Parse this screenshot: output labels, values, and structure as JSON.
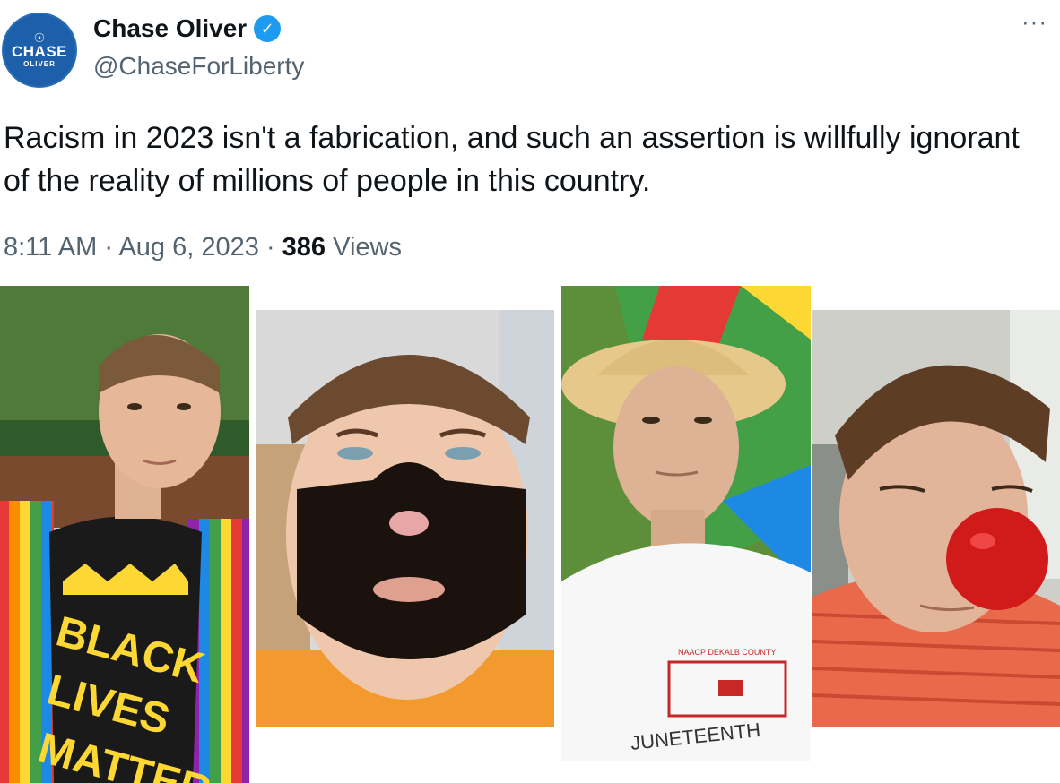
{
  "author": {
    "avatar_text_line1": "CHASE",
    "avatar_text_line2": "OLIVER",
    "display_name": "Chase Oliver",
    "handle": "@ChaseForLiberty",
    "verified": true
  },
  "tweet": {
    "text": "Racism in 2023 isn't a fabrication, and such an assertion is willfully ignorant of the reality of millions of people in this country.",
    "time": "8:11 AM",
    "date": "Aug 6, 2023",
    "views_count": "386",
    "views_label": "Views",
    "separator": "·"
  },
  "menu": {
    "more_icon": "more-horizontal-icon",
    "label": "···"
  },
  "photos": {
    "photo1": {
      "shirt_text_1": "BLACK",
      "shirt_text_2": "LIVES",
      "shirt_text_3": "MATTER"
    },
    "photo3": {
      "shirt_small": "NAACP DEKALB COUNTY",
      "shirt_big": "JUNETEENTH"
    }
  },
  "colors": {
    "verified": "#1d9bf0",
    "avatar_bg": "#1d5fa8",
    "secondary_text": "#536471"
  }
}
